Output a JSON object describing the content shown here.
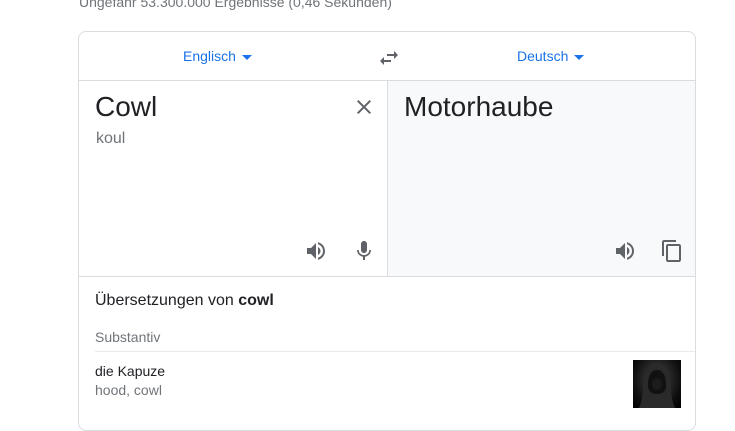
{
  "result_stats": "Ungefähr 53.300.000 Ergebnisse (0,46 Sekunden)",
  "translator": {
    "source_language": "Englisch",
    "target_language": "Deutsch",
    "source_text": "Cowl",
    "transliteration": "koul",
    "translated_text": "Motorhaube"
  },
  "icons": {
    "swap": "swap-arrows-icon",
    "clear": "close-icon",
    "listen": "speaker-icon",
    "voice": "microphone-icon",
    "copy": "copy-icon"
  },
  "dictionary": {
    "title_prefix": "Übersetzungen von",
    "title_word": "cowl",
    "part_of_speech": "Substantiv",
    "entries": [
      {
        "word": "die Kapuze",
        "synonyms": "hood, cowl"
      }
    ]
  },
  "colors": {
    "accent": "#1a73e8",
    "border": "#dadce0",
    "target_bg": "#f8f9fa",
    "muted_text": "#70757a"
  }
}
